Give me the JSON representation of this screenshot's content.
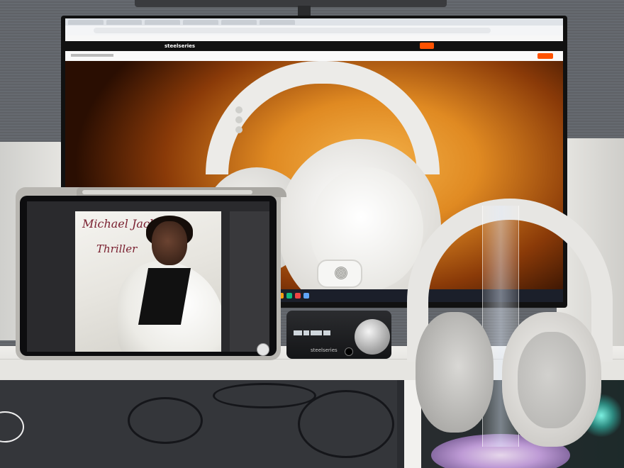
{
  "monitor": {
    "site": {
      "logo": "steelseries"
    },
    "colors": {
      "accent": "#ff5200",
      "hero_warm": "#e08a22"
    }
  },
  "tablet": {
    "album": {
      "artist": "Michael Jackson",
      "title": "Thriller"
    }
  },
  "dac": {
    "brand": "steelseries",
    "knob": "volume-knob-icon"
  },
  "headphones": {
    "color": "#e7e6e3"
  }
}
